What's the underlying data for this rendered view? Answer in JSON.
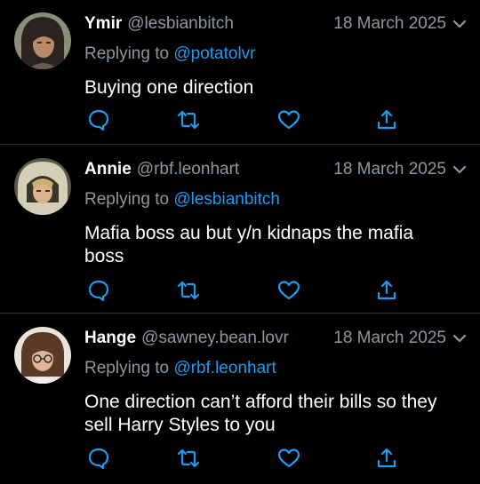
{
  "tweets": [
    {
      "name": "Ymir",
      "handle": "@lesbianbitch",
      "date": "18 March 2025",
      "replying_prefix": "Replying to ",
      "replying_to": "@potatolvr",
      "text": "Buying one direction"
    },
    {
      "name": "Annie",
      "handle": "@rbf.leonhart",
      "date": "18 March 2025",
      "replying_prefix": "Replying to ",
      "replying_to": "@lesbianbitch",
      "text": "Mafia boss au but y/n kidnaps the mafia boss"
    },
    {
      "name": "Hange",
      "handle": "@sawney.bean.lovr",
      "date": "18 March 2025",
      "replying_prefix": "Replying to ",
      "replying_to": "@rbf.leonhart",
      "text": "One direction can’t afford their bills so they sell Harry Styles to you"
    }
  ],
  "icons": {
    "reply": "reply-icon",
    "retweet": "retweet-icon",
    "like": "heart-icon",
    "share": "share-icon",
    "menu": "chevron-down-icon"
  },
  "colors": {
    "background": "#000000",
    "name": "#ffffff",
    "secondary": "#8b98a5",
    "mention": "#1d9bf0",
    "divider": "#2f3336"
  }
}
